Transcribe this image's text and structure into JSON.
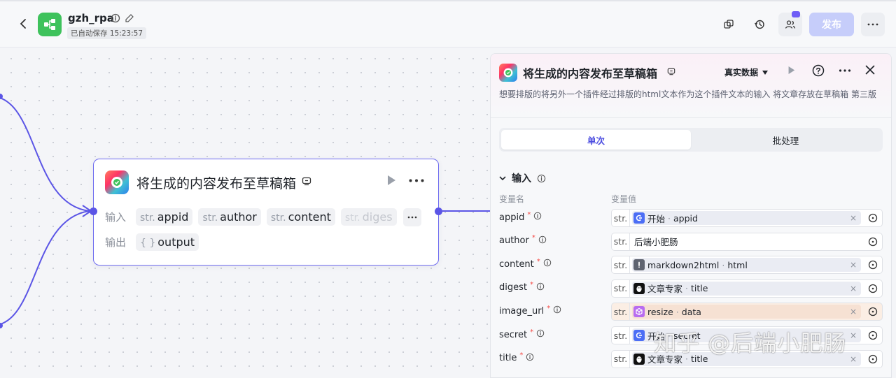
{
  "header": {
    "app_name": "gzh_rpa",
    "autosave": "已自动保存 15:23:57",
    "publish_label": "发布"
  },
  "node": {
    "title": "将生成的内容发布至草稿箱",
    "input_label": "输入",
    "output_label": "输出",
    "inputs": [
      {
        "type": "str.",
        "name": "appid"
      },
      {
        "type": "str.",
        "name": "author"
      },
      {
        "type": "str.",
        "name": "content"
      },
      {
        "type": "str.",
        "name": "diges"
      }
    ],
    "output": {
      "type": "{ }",
      "name": "output"
    }
  },
  "panel": {
    "title": "将生成的内容发布至草稿箱",
    "data_mode": "真实数据",
    "description": "想要排版的将另外一个插件经过排版的html文本作为这个插件文本的输入 将文章存放在草稿箱 第三版",
    "tabs": [
      {
        "label": "单次",
        "active": true
      },
      {
        "label": "批处理",
        "active": false
      }
    ],
    "section_title": "输入",
    "col_name": "变量名",
    "col_value": "变量值",
    "rows": [
      {
        "name": "appid",
        "type": "str.",
        "ref_icon": "start-icon",
        "ref_color": "#4c6ef5",
        "source": "开始",
        "field": "appid",
        "highlight": false
      },
      {
        "name": "author",
        "type": "str.",
        "plain": "后端小肥肠"
      },
      {
        "name": "content",
        "type": "str.",
        "ref_icon": "alert-icon",
        "ref_color": "#5f6470",
        "source": "markdown2html",
        "field": "html",
        "highlight": false
      },
      {
        "name": "digest",
        "type": "str.",
        "ref_icon": "penguin-icon",
        "ref_color": "#111111",
        "source": "文章专家",
        "field": "title",
        "highlight": false
      },
      {
        "name": "image_url",
        "type": "str.",
        "ref_icon": "cube-icon",
        "ref_color": "#b86cf0",
        "source": "resize",
        "field": "data",
        "highlight": true
      },
      {
        "name": "secret",
        "type": "str.",
        "ref_icon": "start-icon",
        "ref_color": "#4c6ef5",
        "source": "开始",
        "field": "secret",
        "highlight": false
      },
      {
        "name": "title",
        "type": "str.",
        "ref_icon": "penguin-icon",
        "ref_color": "#111111",
        "source": "文章专家",
        "field": "title",
        "highlight": false
      }
    ]
  },
  "watermark": "知乎 @后端小肥肠",
  "colors": {
    "accent": "#5b55e6",
    "publish": "#c6cdfa",
    "required": "#f54a45"
  }
}
